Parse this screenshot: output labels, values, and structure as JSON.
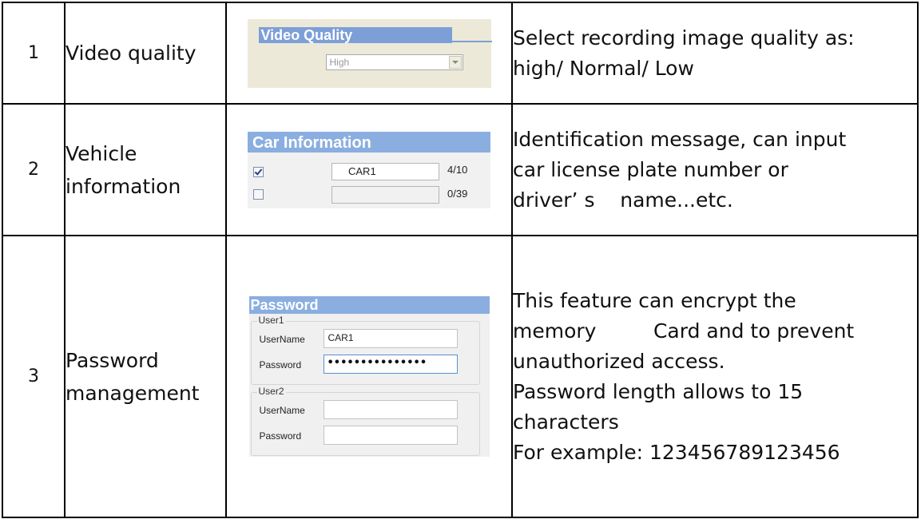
{
  "rows": [
    {
      "number": "1",
      "name": [
        "Video quality"
      ],
      "screenshot": {
        "title": "Video Quality",
        "select_value": "High"
      },
      "description": [
        "Select recording image quality as:",
        "high/ Normal/ Low"
      ]
    },
    {
      "number": "2",
      "name": [
        "Vehicle",
        "information"
      ],
      "screenshot": {
        "title": "Car Information",
        "rows": [
          {
            "checked": true,
            "value": "CAR1",
            "count": "4/10"
          },
          {
            "checked": false,
            "value": "",
            "count": "0/39"
          }
        ]
      },
      "description": [
        "Identification message, can input",
        "car license plate number or",
        "driver’ s    name...etc."
      ]
    },
    {
      "number": "3",
      "name": [
        "Password",
        "management"
      ],
      "screenshot": {
        "title": "Password",
        "user1": {
          "legend": "User1",
          "username_label": "UserName",
          "username_value": "CAR1",
          "password_label": "Password",
          "password_value": "•••••••••••••••"
        },
        "user2": {
          "legend": "User2",
          "username_label": "UserName",
          "username_value": "",
          "password_label": "Password",
          "password_value": ""
        }
      },
      "description": [
        "This feature can encrypt the",
        "memory         Card and to prevent",
        "unauthorized access.",
        "Password length allows to 15",
        "characters",
        "For example: 123456789123456"
      ]
    }
  ]
}
